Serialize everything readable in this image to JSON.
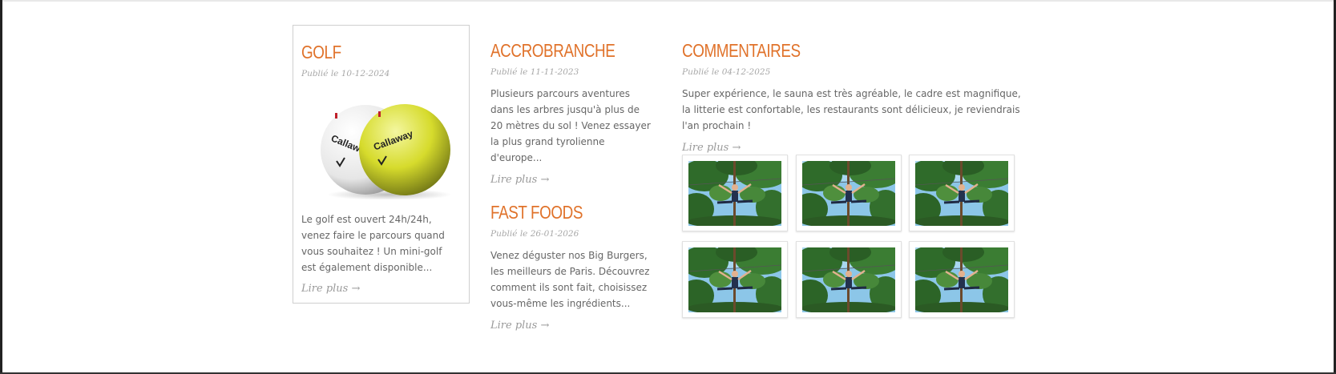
{
  "posts": [
    {
      "title": "GOLF",
      "date": "Publié le 10-12-2024",
      "excerpt": "Le golf est ouvert 24h/24h, venez faire le parcours quand vous souhaitez ! Un mini-golf est également disponible...",
      "more": "Lire plus →",
      "image": "golf-balls-image",
      "ball_brand": "Callaway"
    },
    {
      "title": "ACCROBRANCHE",
      "date": "Publié le 11-11-2023",
      "excerpt": "Plusieurs parcours aventures dans les arbres jusqu'à plus de 20 mètres du sol ! Venez essayer la plus grand tyrolienne d'europe...",
      "more": "Lire plus →"
    },
    {
      "title": "FAST FOODS",
      "date": "Publié le 26-01-2026",
      "excerpt": "Venez déguster nos Big Burgers, les meilleurs de Paris. Découvrez comment ils sont fait, choisissez vous-même les ingrédients...",
      "more": "Lire plus →"
    },
    {
      "title": "COMMENTAIRES",
      "date": "Publié le 04-12-2025",
      "excerpt": "Super expérience, le sauna est très agréable, le cadre est magnifique, la litterie est confortable, les restaurants sont délicieux, je reviendrais l'an prochain !",
      "more": "Lire plus →"
    }
  ],
  "gallery": {
    "items": [
      "tree-jump-photo",
      "tree-jump-photo",
      "tree-jump-photo",
      "tree-jump-photo",
      "tree-jump-photo",
      "tree-jump-photo"
    ]
  },
  "colors": {
    "title": "#e0722a",
    "date": "#a8a8a8",
    "text": "#666666",
    "link": "#9a9a9a"
  }
}
